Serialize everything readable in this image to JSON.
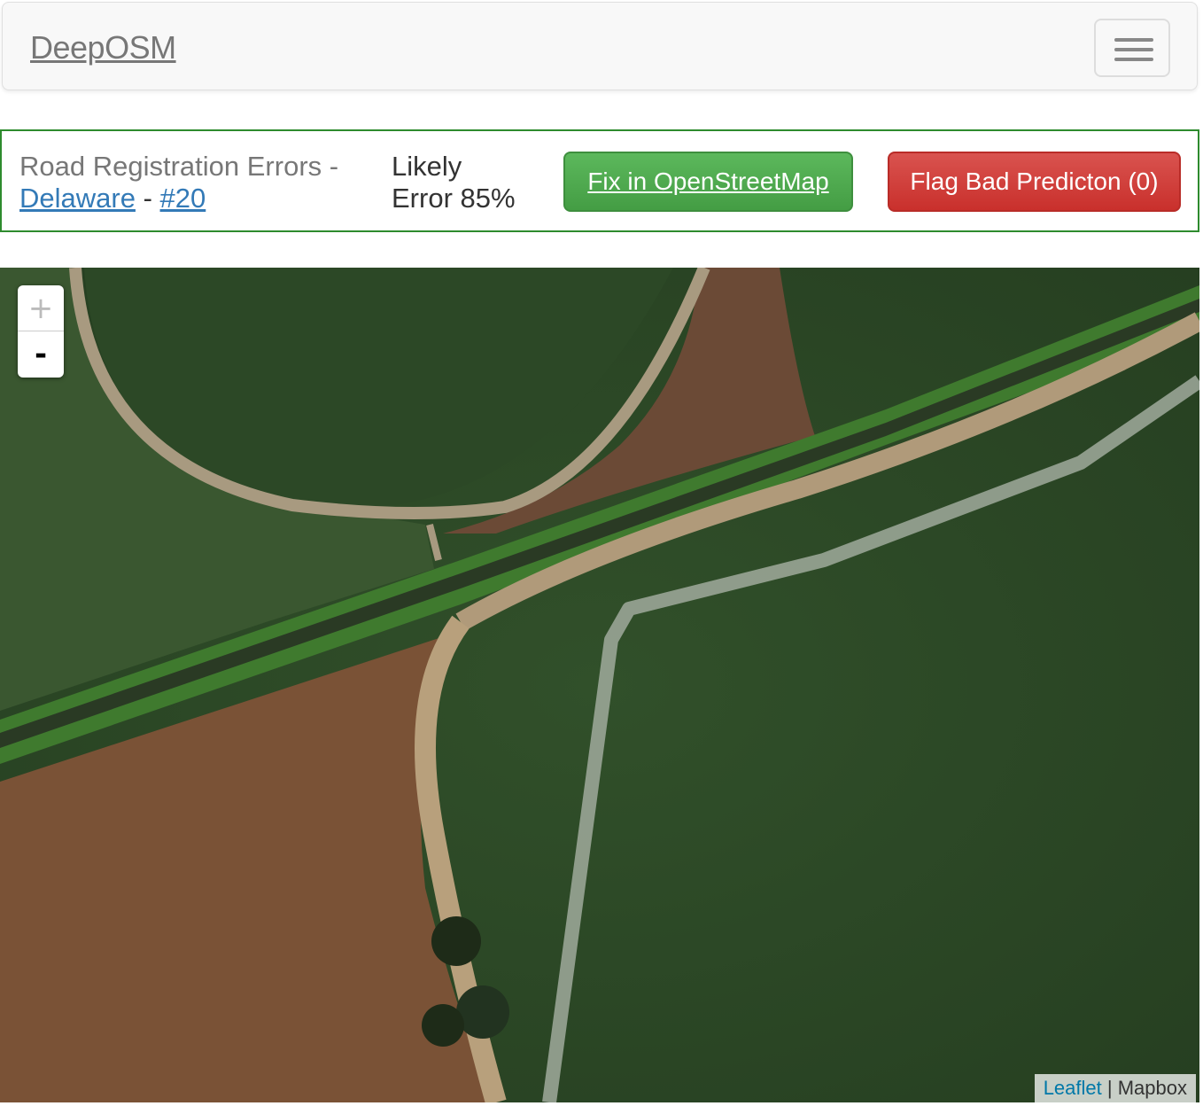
{
  "navbar": {
    "brand": "DeepOSM",
    "menu_icon": "hamburger-menu-icon"
  },
  "error_info": {
    "title_prefix": "Road Registration Errors -",
    "state_link": "Delaware",
    "separator": "-",
    "id_link": "#20",
    "likelihood_line1": "Likely",
    "likelihood_line2": "Error 85%"
  },
  "actions": {
    "fix_label": "Fix in OpenStreetMap",
    "flag_label": "Flag Bad Predicton (0)"
  },
  "map": {
    "zoom_in": "+",
    "zoom_out": "-",
    "attribution_leaflet": "Leaflet",
    "attribution_separator": "|",
    "attribution_provider": "Mapbox"
  },
  "colors": {
    "success": "#5cb85c",
    "danger": "#d9534f",
    "link": "#337ab7",
    "infobar_border": "#2e8b2e"
  }
}
